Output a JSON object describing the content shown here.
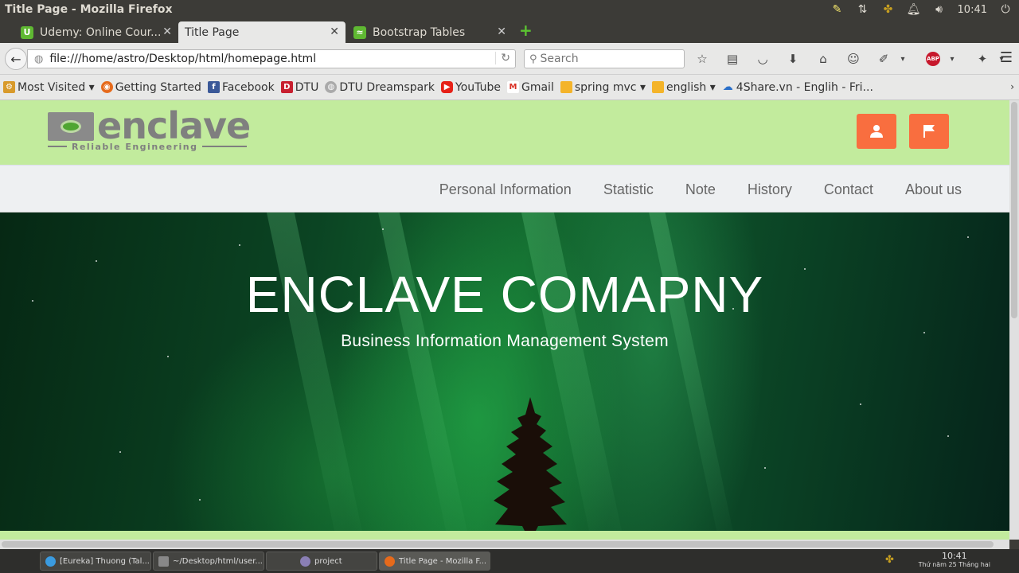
{
  "window": {
    "title": "Title Page - Mozilla Firefox"
  },
  "indicators": {
    "clock": "10:41"
  },
  "tabs": [
    {
      "label": "Udemy: Online Cour...",
      "favicon_letter": "U",
      "favicon_color": "#5fb832",
      "active": false
    },
    {
      "label": "Title Page",
      "favicon_letter": "",
      "favicon_color": "",
      "active": true
    },
    {
      "label": "Bootstrap Tables",
      "favicon_letter": "",
      "favicon_color": "#5fb832",
      "active": false
    }
  ],
  "navbar": {
    "url": "file:///home/astro/Desktop/html/homepage.html",
    "search_placeholder": "Search"
  },
  "bookmarks": [
    {
      "label": "Most Visited ▾",
      "icon": "gear-folder-icon"
    },
    {
      "label": "Getting Started",
      "icon": "firefox-icon"
    },
    {
      "label": "Facebook",
      "icon": "facebook-icon"
    },
    {
      "label": "DTU",
      "icon": "dtu-icon"
    },
    {
      "label": "DTU Dreamspark",
      "icon": "globe-icon"
    },
    {
      "label": "YouTube",
      "icon": "youtube-icon"
    },
    {
      "label": "Gmail",
      "icon": "gmail-icon"
    },
    {
      "label": "spring mvc ▾",
      "icon": "folder-icon"
    },
    {
      "label": "english ▾",
      "icon": "folder-icon"
    },
    {
      "label": "4Share.vn - Englih - Fri...",
      "icon": "cloud-icon"
    }
  ],
  "site": {
    "logo_word": "enclave",
    "logo_tagline": "Reliable Engineering",
    "nav": [
      "Personal Information",
      "Statistic",
      "Note",
      "History",
      "Contact",
      "About us"
    ],
    "hero_title": "ENCLAVE COMAPNY",
    "hero_subtitle": "Business Information Management System",
    "colors": {
      "header_bg": "#c2eb9d",
      "accent_button": "#f96e3f",
      "nav_bg": "#eef0f2"
    }
  },
  "taskbar": {
    "tasks": [
      {
        "label": "[Eureka] Thuong (Tal...",
        "active": false
      },
      {
        "label": "~/Desktop/html/user...",
        "active": false
      },
      {
        "label": "project",
        "active": false
      },
      {
        "label": "Title Page - Mozilla F...",
        "active": true
      }
    ],
    "time": "10:41",
    "date": "Thứ năm 25 Tháng hai"
  }
}
